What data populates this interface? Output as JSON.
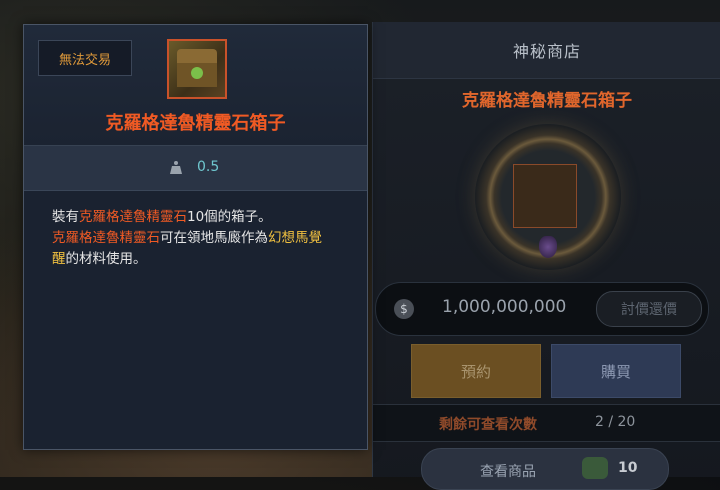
{
  "shop": {
    "title": "神秘商店",
    "item_title": "克羅格達魯精靈石箱子",
    "price": "1,000,000,000",
    "coupon_label": "討價還價",
    "reserve_label": "預約",
    "buy_label": "購買",
    "remaining_label": "剩餘可查看次數",
    "remaining_count": "2 / 20",
    "view_label": "查看商品",
    "view_count": "10"
  },
  "tooltip": {
    "badge": "無法交易",
    "item_name": "克羅格達魯精靈石箱子",
    "weight": "0.5",
    "desc": {
      "l1_a": "裝有",
      "l1_b": "克羅格達魯精靈石",
      "l1_c": "10個的箱子。",
      "l2_a": "克羅格達魯精靈石",
      "l2_b": "可在領地馬廄作為",
      "l2_c": "幻想馬覺",
      "l3_a": "醒",
      "l3_b": "的材料使用。"
    }
  },
  "colors": {
    "item_orange": "#f05a24",
    "highlight_yellow": "#f0c040",
    "weight_cyan": "#6fc7cf"
  }
}
